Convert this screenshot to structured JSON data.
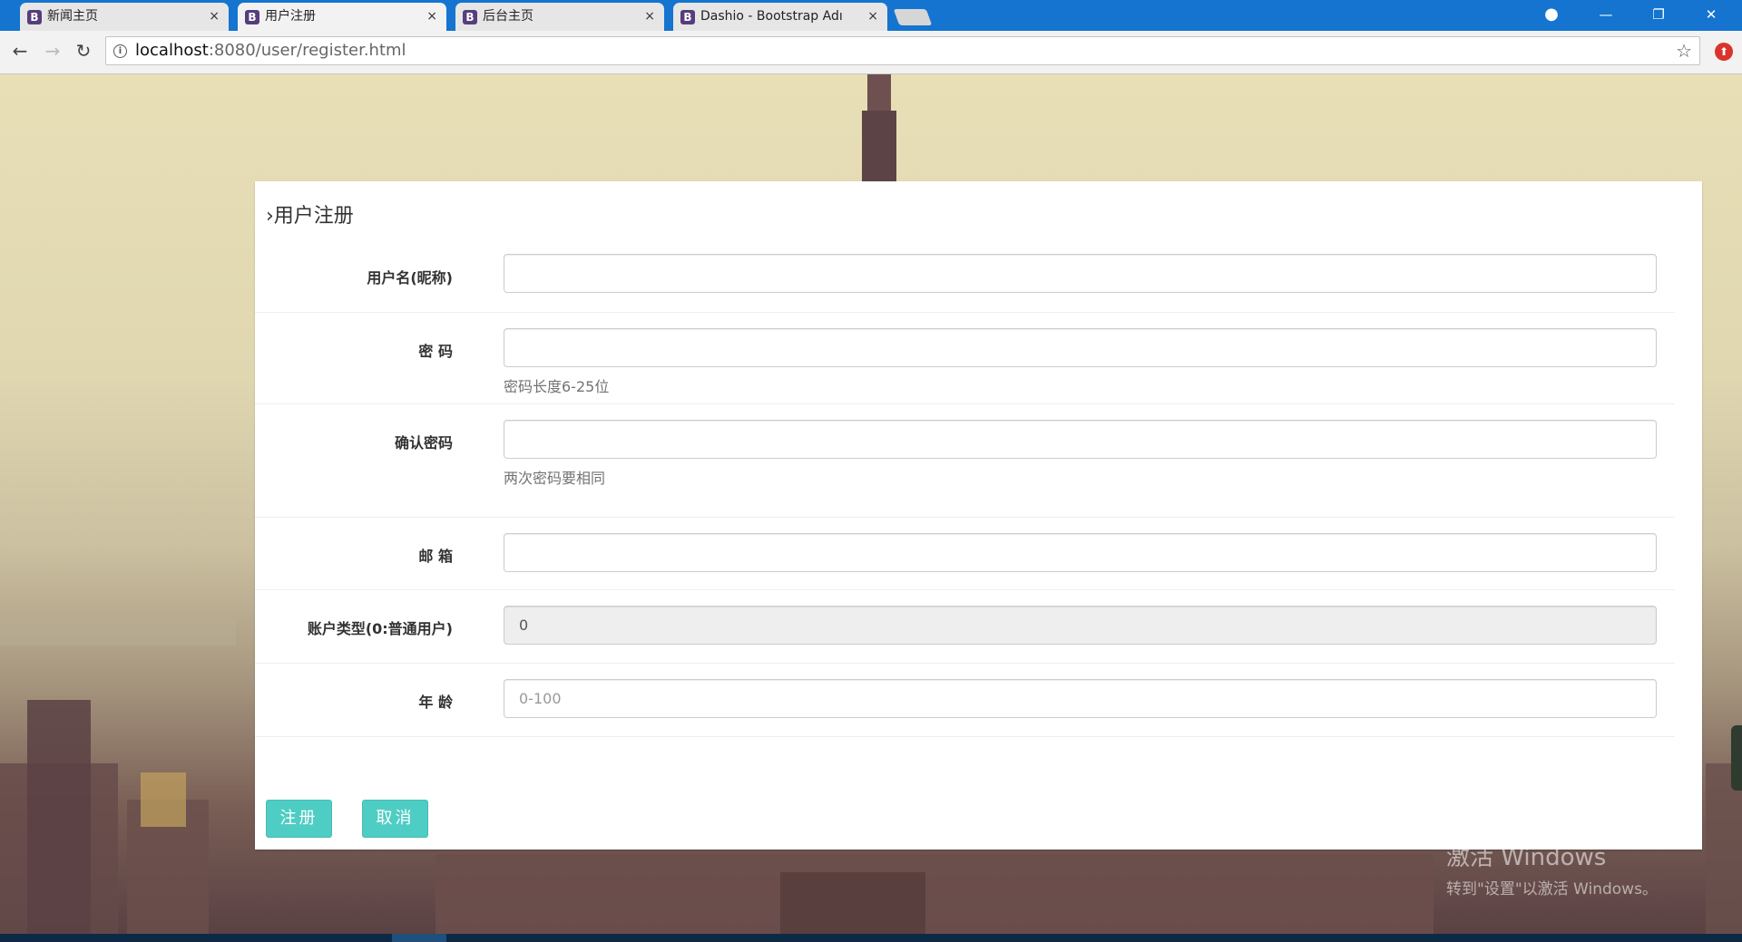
{
  "browser": {
    "tabs": [
      {
        "favicon": "B",
        "title": "新闻主页",
        "close": "×"
      },
      {
        "favicon": "B",
        "title": "用户注册",
        "close": "×"
      },
      {
        "favicon": "B",
        "title": "后台主页",
        "close": "×"
      },
      {
        "favicon": "B",
        "title": "Dashio - Bootstrap Adı",
        "close": "×"
      }
    ],
    "url_host": "localhost",
    "url_path": ":8080/user/register.html",
    "window_controls": {
      "minimize": "—",
      "restore": "❐",
      "close": "✕"
    },
    "nav": {
      "back": "←",
      "forward": "→",
      "reload": "↻"
    },
    "icons": {
      "info": "i",
      "star": "☆",
      "profile": "●",
      "extension": "⬆"
    }
  },
  "form": {
    "title": "›用户注册",
    "fields": [
      {
        "label": "用户名(昵称)",
        "value": "",
        "placeholder": "",
        "help": ""
      },
      {
        "label": "密 码",
        "value": "",
        "placeholder": "",
        "help": "密码长度6-25位"
      },
      {
        "label": "确认密码",
        "value": "",
        "placeholder": "",
        "help": "两次密码要相同"
      },
      {
        "label": "邮 箱",
        "value": "",
        "placeholder": "",
        "help": ""
      },
      {
        "label": "账户类型(0:普通用户)",
        "value": "0",
        "placeholder": "",
        "help": ""
      },
      {
        "label": "年 龄",
        "value": "",
        "placeholder": "0-100",
        "help": ""
      }
    ],
    "buttons": {
      "submit": "注册",
      "cancel": "取消"
    }
  },
  "watermark": {
    "line1": "激活 Windows",
    "line2": "转到\"设置\"以激活 Windows。"
  }
}
